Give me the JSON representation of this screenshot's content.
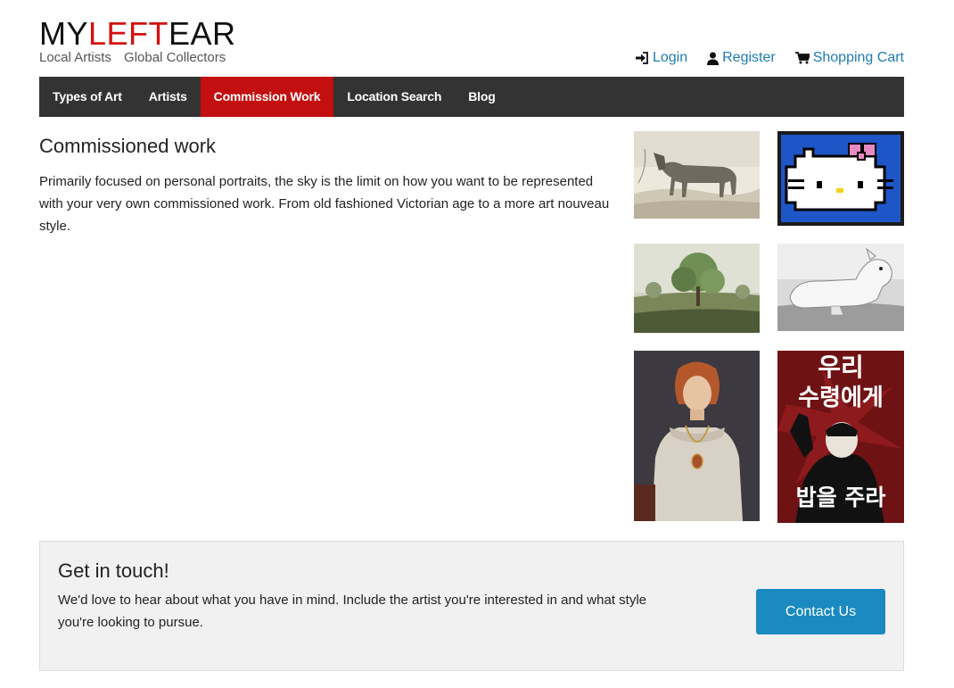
{
  "brand": {
    "logo_part1": "MY",
    "logo_part2": "LEFT",
    "logo_part3": "EAR",
    "tagline_left": "Local Artists",
    "tagline_right": "Global Collectors",
    "accent_color": "#d21111"
  },
  "user_links": {
    "login": "Login",
    "register": "Register",
    "cart": "Shopping Cart",
    "link_color": "#1f7bb0"
  },
  "nav": {
    "items": [
      "Types of Art",
      "Artists",
      "Commission Work",
      "Location Search",
      "Blog"
    ],
    "active": "Commission Work"
  },
  "main": {
    "title": "Commissioned work",
    "body": "Primarily focused on personal portraits, the sky is the limit on how you want to be represented with your very own commissioned work. From old fashioned Victorian age to a more art nouveau style."
  },
  "gallery": {
    "images": [
      "horse-sketch",
      "pixel-cat",
      "tree-landscape",
      "bull-terrier",
      "renaissance-portrait",
      "propaganda-poster"
    ],
    "poster_text_top_1": "우리",
    "poster_text_top_2": "수령에게",
    "poster_text_bottom": "밥을 주라"
  },
  "contact": {
    "title": "Get in touch!",
    "body": "We'd love to hear about what you have in mind. Include the artist you're interested in and what style you're looking to pursue.",
    "button": "Contact Us",
    "button_color": "#1a8ac0"
  }
}
